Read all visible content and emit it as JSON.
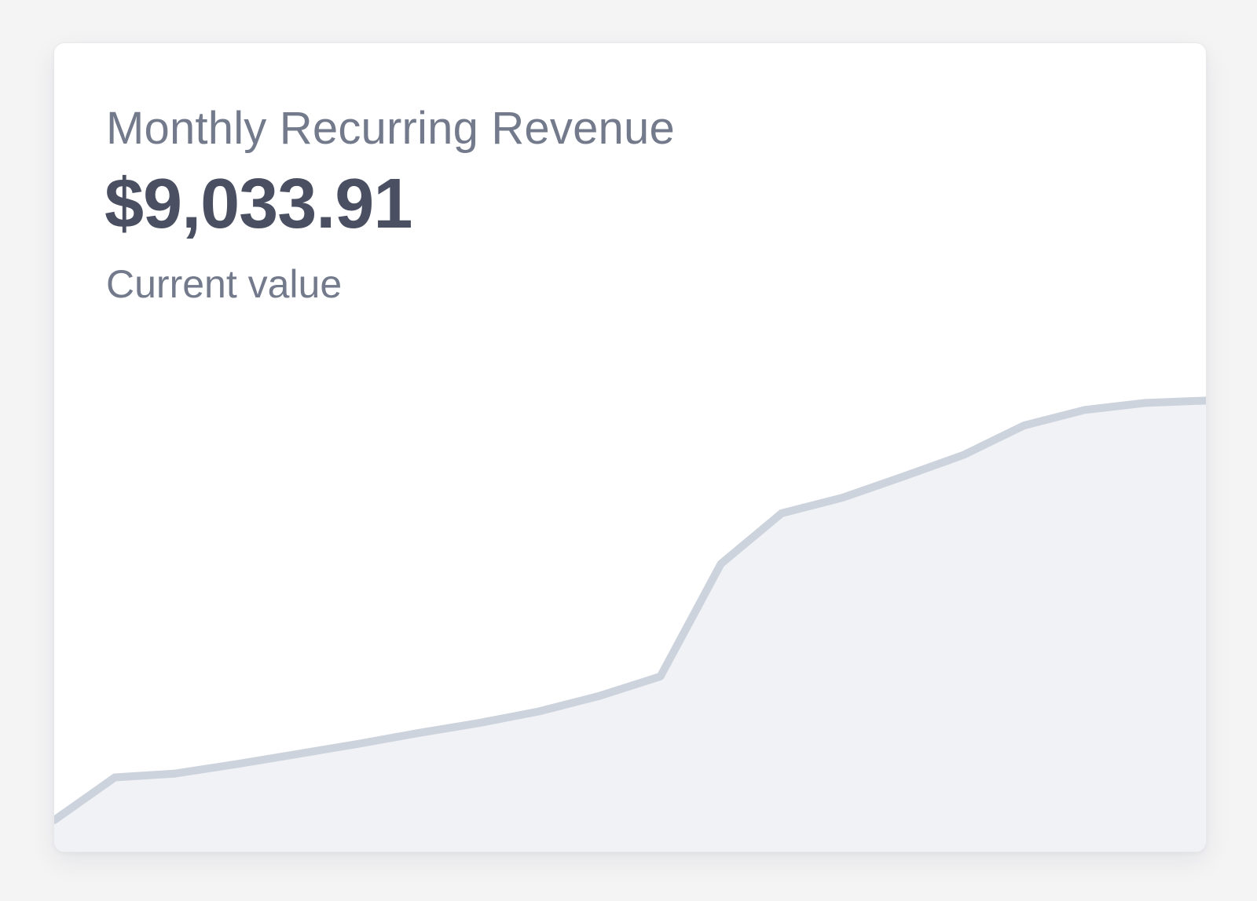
{
  "metric": {
    "title": "Monthly Recurring Revenue",
    "value": "$9,033.91",
    "caption": "Current value"
  },
  "colors": {
    "line": "#cdd3dc",
    "fill": "#f0f2f6",
    "title": "#737a8b",
    "value": "#4a5062"
  },
  "chart_data": {
    "type": "area",
    "values": [
      0,
      55,
      60,
      72,
      85,
      98,
      112,
      125,
      140,
      160,
      185,
      330,
      395,
      415,
      442,
      470,
      508,
      528,
      537,
      540
    ],
    "ylim": [
      0,
      1000
    ],
    "grid": false
  }
}
